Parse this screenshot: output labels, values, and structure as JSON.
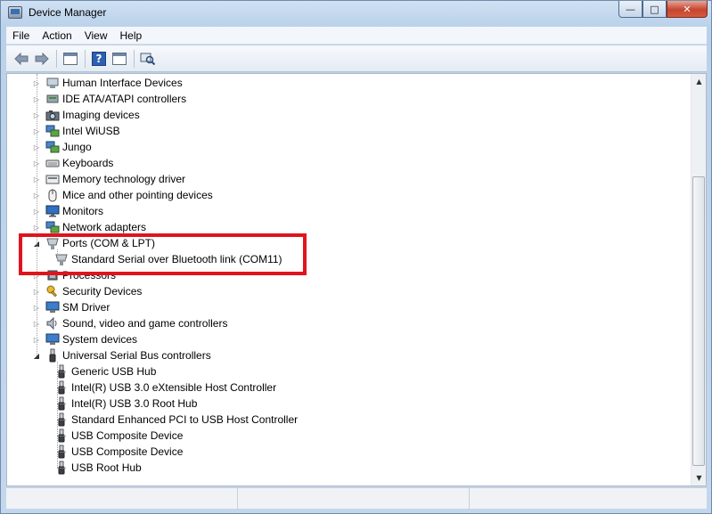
{
  "window": {
    "title": "Device Manager",
    "caption_minimize": "—",
    "caption_maximize": "□",
    "caption_close": "✕"
  },
  "menu": [
    "File",
    "Action",
    "View",
    "Help"
  ],
  "toolbar": {
    "icons": [
      "back-arrow-icon",
      "forward-arrow-icon",
      "show-hide-console-tree-icon",
      "help-icon",
      "properties-icon",
      "scan-hardware-icon"
    ],
    "help_glyph": "?"
  },
  "tree": {
    "nodes": [
      {
        "label": "Human Interface Devices",
        "icon": "hid-icon",
        "expanded": false,
        "level": 0
      },
      {
        "label": "IDE ATA/ATAPI controllers",
        "icon": "ide-controller-icon",
        "expanded": false,
        "level": 0
      },
      {
        "label": "Imaging devices",
        "icon": "camera-icon",
        "expanded": false,
        "level": 0
      },
      {
        "label": "Intel WiUSB",
        "icon": "network-icon",
        "expanded": false,
        "level": 0
      },
      {
        "label": "Jungo",
        "icon": "network-icon",
        "expanded": false,
        "level": 0
      },
      {
        "label": "Keyboards",
        "icon": "keyboard-icon",
        "expanded": false,
        "level": 0
      },
      {
        "label": "Memory technology driver",
        "icon": "memory-icon",
        "expanded": false,
        "level": 0
      },
      {
        "label": "Mice and other pointing devices",
        "icon": "mouse-icon",
        "expanded": false,
        "level": 0
      },
      {
        "label": "Monitors",
        "icon": "monitor-icon",
        "expanded": false,
        "level": 0
      },
      {
        "label": "Network adapters",
        "icon": "network-icon",
        "expanded": false,
        "level": 0
      },
      {
        "label": "Ports (COM & LPT)",
        "icon": "port-icon",
        "expanded": true,
        "level": 0
      },
      {
        "label": "Standard Serial over Bluetooth link (COM11)",
        "icon": "port-icon",
        "level": 1
      },
      {
        "label": "Processors",
        "icon": "processor-icon",
        "expanded": false,
        "level": 0
      },
      {
        "label": "Security Devices",
        "icon": "key-icon",
        "expanded": false,
        "level": 0
      },
      {
        "label": "SM Driver",
        "icon": "computer-icon",
        "expanded": false,
        "level": 0
      },
      {
        "label": "Sound, video and game controllers",
        "icon": "speaker-icon",
        "expanded": false,
        "level": 0
      },
      {
        "label": "System devices",
        "icon": "computer-icon",
        "expanded": false,
        "level": 0
      },
      {
        "label": "Universal Serial Bus controllers",
        "icon": "usb-icon",
        "expanded": true,
        "level": 0
      },
      {
        "label": "Generic USB Hub",
        "icon": "usb-icon",
        "level": 1
      },
      {
        "label": "Intel(R) USB 3.0 eXtensible Host Controller",
        "icon": "usb-icon",
        "level": 1
      },
      {
        "label": "Intel(R) USB 3.0 Root Hub",
        "icon": "usb-icon",
        "level": 1
      },
      {
        "label": "Standard Enhanced PCI to USB Host Controller",
        "icon": "usb-icon",
        "level": 1
      },
      {
        "label": "USB Composite Device",
        "icon": "usb-icon",
        "level": 1
      },
      {
        "label": "USB Composite Device",
        "icon": "usb-icon",
        "level": 1
      },
      {
        "label": "USB Root Hub",
        "icon": "usb-icon",
        "level": 1
      }
    ]
  },
  "scrollbar": {
    "up": "▲",
    "down": "▼"
  },
  "colors": {
    "highlight_box": "#e0141e",
    "close_button": "#c6452f"
  }
}
